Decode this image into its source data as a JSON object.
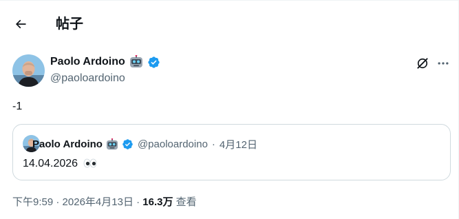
{
  "header": {
    "title": "帖子",
    "back_icon": "arrow-left-icon"
  },
  "post": {
    "author_name": "Paolo Ardoino",
    "author_emoji": "robot-emoji",
    "verified_icon": "verified-badge-icon",
    "handle": "@paoloardoino",
    "text": "-1"
  },
  "quote": {
    "author_name": "Paolo Ardoino",
    "handle": "@paoloardoino",
    "separator": "·",
    "date": "4月12日",
    "text": "14.04.2026",
    "text_emoji": "eyes-emoji"
  },
  "meta": {
    "time": "下午9:59",
    "separator": "·",
    "date": "2026年4月13日",
    "views": "16.3万",
    "views_label": "查看"
  },
  "colors": {
    "text": "#0f1419",
    "secondary": "#536471",
    "verified": "#1d9bf0",
    "border": "#cfd9de"
  }
}
